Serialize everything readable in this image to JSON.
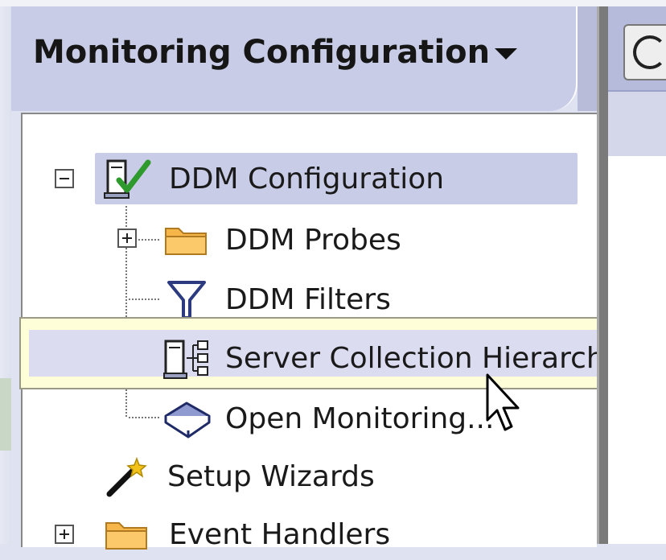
{
  "panel": {
    "title": "Monitoring Configuration"
  },
  "tree": {
    "ddm_configuration": "DDM Configuration",
    "ddm_probes": "DDM Probes",
    "ddm_filters": "DDM Filters",
    "server_collection_hierarchy": "Server Collection Hierarchy",
    "open_monitoring": "Open Monitoring...",
    "setup_wizards": "Setup Wizards",
    "event_handlers": "Event Handlers"
  },
  "icons": {
    "ddm_configuration": "server-check-icon",
    "ddm_probes": "folder-icon",
    "ddm_filters": "filter-funnel-icon",
    "server_collection_hierarchy": "server-hierarchy-icon",
    "open_monitoring": "book-icon",
    "setup_wizards": "magic-wand-icon",
    "event_handlers": "folder-icon"
  },
  "colors": {
    "selection": "#c9cce6",
    "tooltip_background": "#fefed9",
    "folder": "#f6b64a",
    "check": "#2e9a2e"
  }
}
